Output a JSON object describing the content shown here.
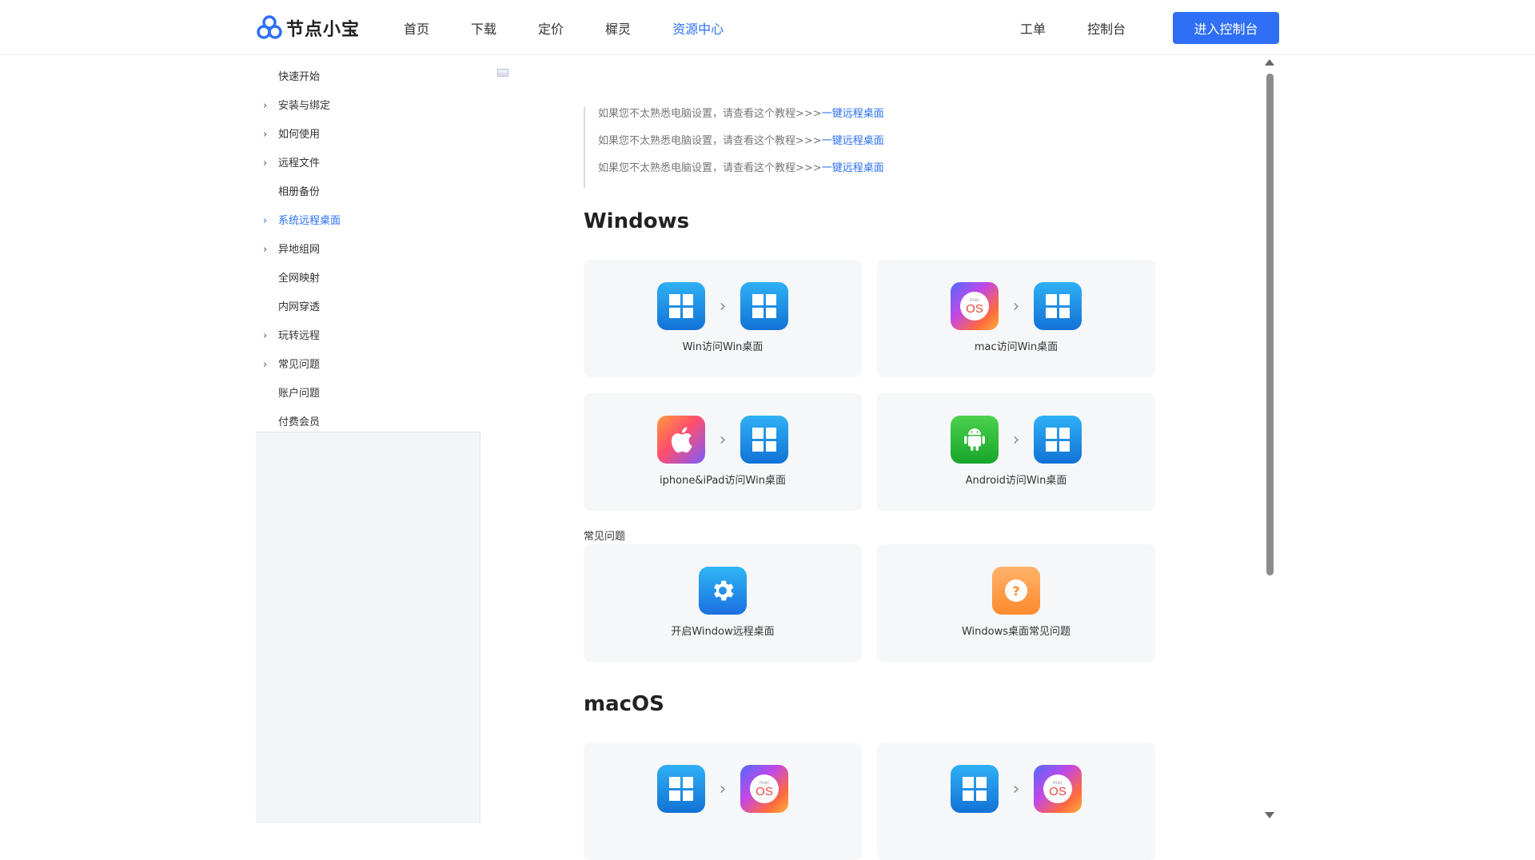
{
  "header": {
    "logo_text": "节点小宝",
    "nav": [
      "首页",
      "下载",
      "定价",
      "樨灵",
      "资源中心"
    ],
    "active_nav": "资源中心",
    "right_links": [
      "工单",
      "控制台"
    ],
    "console_button": "进入控制台",
    "accent_color": "#2f6ff5"
  },
  "sidebar": {
    "items": [
      {
        "label": "快速开始",
        "chevron": false
      },
      {
        "label": "安装与绑定",
        "chevron": true
      },
      {
        "label": "如何使用",
        "chevron": true
      },
      {
        "label": "远程文件",
        "chevron": true
      },
      {
        "label": "相册备份",
        "chevron": false
      },
      {
        "label": "系统远程桌面",
        "chevron": true,
        "active": true
      },
      {
        "label": "异地组网",
        "chevron": true
      },
      {
        "label": "全网映射",
        "chevron": false
      },
      {
        "label": "内网穿透",
        "chevron": false
      },
      {
        "label": "玩转远程",
        "chevron": true
      },
      {
        "label": "常见问题",
        "chevron": true
      },
      {
        "label": "账户问题",
        "chevron": false
      },
      {
        "label": "付费会员",
        "chevron": false
      }
    ]
  },
  "main": {
    "notes": [
      {
        "text": "如果您不太熟悉电脑设置，请查看这个教程>>>",
        "link": "一键远程桌面"
      },
      {
        "text": "如果您不太熟悉电脑设置，请查看这个教程>>>",
        "link": "一键远程桌面"
      },
      {
        "text": "如果您不太熟悉电脑设置，请查看这个教程>>>",
        "link": "一键远程桌面"
      }
    ],
    "windows_heading": "Windows",
    "windows_cards": [
      {
        "label": "Win访问Win桌面",
        "from": "windows-icon",
        "to": "windows-icon"
      },
      {
        "label": "mac访问Win桌面",
        "from": "macos-icon",
        "to": "windows-icon"
      },
      {
        "label": "iphone&iPad访问Win桌面",
        "from": "apple-icon",
        "to": "windows-icon"
      },
      {
        "label": "Android访问Win桌面",
        "from": "android-icon",
        "to": "windows-icon"
      }
    ],
    "faq_label": "常见问题",
    "faq_cards": [
      {
        "label": "开启Window远程桌面",
        "icon": "gear-icon"
      },
      {
        "label": "Windows桌面常见问题",
        "icon": "question-icon"
      }
    ],
    "macos_heading": "macOS",
    "macos_cards": [
      {
        "from": "windows-icon",
        "to": "macos-icon"
      },
      {
        "from": "windows-icon",
        "to": "macos-icon"
      }
    ],
    "arrow_glyph": "›",
    "macos_badge_small": "mac",
    "macos_badge_big": "OS",
    "question_glyph": "?"
  }
}
